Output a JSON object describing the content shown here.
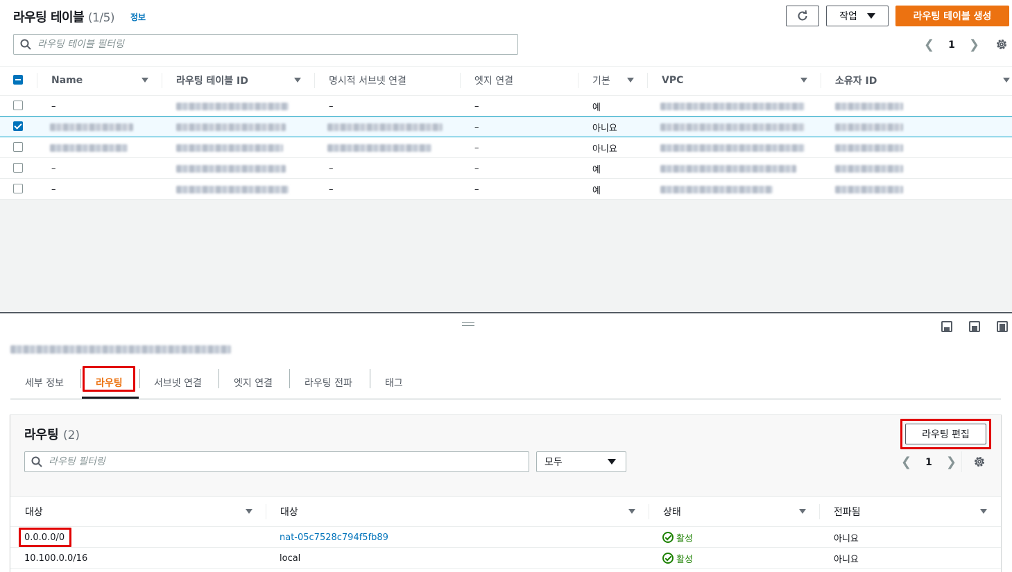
{
  "header": {
    "title": "라우팅 테이블",
    "count": "(1/5)",
    "info_link": "정보",
    "actions_label": "작업",
    "create_label": "라우팅 테이블 생성"
  },
  "filter": {
    "placeholder": "라우팅 테이블 필터링"
  },
  "pagination": {
    "page": "1"
  },
  "table": {
    "columns": [
      "Name",
      "라우팅 테이블 ID",
      "명시적 서브넷 연결",
      "엣지 연결",
      "기본",
      "VPC",
      "소유자 ID"
    ],
    "rows": [
      {
        "name": "–",
        "name_redacted": false,
        "explicit": "–",
        "explicit_redacted": false,
        "edge": "–",
        "main": "예",
        "selected": false
      },
      {
        "name": "",
        "name_redacted": true,
        "explicit": "",
        "explicit_redacted": true,
        "edge": "–",
        "main": "아니요",
        "selected": true
      },
      {
        "name": "",
        "name_redacted": true,
        "explicit": "",
        "explicit_redacted": true,
        "edge": "–",
        "main": "아니요",
        "selected": false
      },
      {
        "name": "–",
        "name_redacted": false,
        "explicit": "–",
        "explicit_redacted": false,
        "edge": "–",
        "main": "예",
        "selected": false
      },
      {
        "name": "–",
        "name_redacted": false,
        "explicit": "–",
        "explicit_redacted": false,
        "edge": "–",
        "main": "예",
        "selected": false
      }
    ]
  },
  "details": {
    "tabs": [
      "세부 정보",
      "라우팅",
      "서브넷 연결",
      "엣지 연결",
      "라우팅 전파",
      "태그"
    ],
    "active_tab": "라우팅"
  },
  "routes": {
    "title": "라우팅",
    "count": "(2)",
    "edit_label": "라우팅 편집",
    "filter_placeholder": "라우팅 필터링",
    "select_value": "모두",
    "page": "1",
    "columns": [
      "대상",
      "대상",
      "상태",
      "전파됨"
    ],
    "rows": [
      {
        "destination": "0.0.0.0/0",
        "target": "nat-05c7528c794f5fb89",
        "status": "활성",
        "propagated": "아니요"
      },
      {
        "destination": "10.100.0.0/16",
        "target": "local",
        "status": "활성",
        "propagated": "아니요"
      }
    ]
  },
  "colors": {
    "primary": "#ec7211",
    "link": "#0073bb",
    "success": "#1d8102",
    "highlight": "#e10000"
  }
}
